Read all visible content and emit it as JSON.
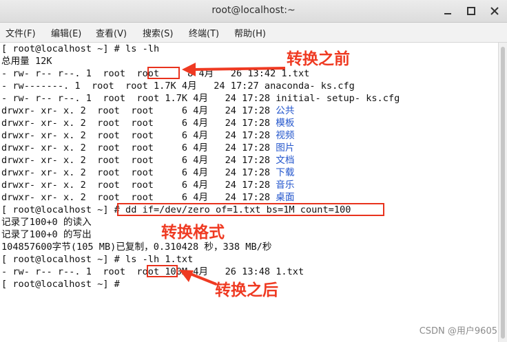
{
  "window": {
    "title": "root@localhost:~",
    "controls": {
      "minimize": "minimize-icon",
      "maximize": "maximize-icon",
      "close": "close-icon"
    }
  },
  "menu": [
    "文件(F)",
    "编辑(E)",
    "查看(V)",
    "搜索(S)",
    "终端(T)",
    "帮助(H)"
  ],
  "terminal": {
    "lines": [
      {
        "text": "[ root@localhost ~] # ls -lh"
      },
      {
        "text": "总用量 12K"
      },
      {
        "text": "- rw- r-- r--. 1  root  root     8 4月   26 13:42 1.txt"
      },
      {
        "text": "- rw-------. 1  root  root 1.7K 4月   24 17:27 anaconda- ks.cfg"
      },
      {
        "text": "- rw- r-- r--. 1  root  root 1.7K 4月   24 17:28 initial- setup- ks.cfg"
      },
      {
        "text": "drwxr- xr- x. 2  root  root     6 4月   24 17:28 ",
        "name": "公共"
      },
      {
        "text": "drwxr- xr- x. 2  root  root     6 4月   24 17:28 ",
        "name": "模板"
      },
      {
        "text": "drwxr- xr- x. 2  root  root     6 4月   24 17:28 ",
        "name": "视频"
      },
      {
        "text": "drwxr- xr- x. 2  root  root     6 4月   24 17:28 ",
        "name": "图片"
      },
      {
        "text": "drwxr- xr- x. 2  root  root     6 4月   24 17:28 ",
        "name": "文档"
      },
      {
        "text": "drwxr- xr- x. 2  root  root     6 4月   24 17:28 ",
        "name": "下载"
      },
      {
        "text": "drwxr- xr- x. 2  root  root     6 4月   24 17:28 ",
        "name": "音乐"
      },
      {
        "text": "drwxr- xr- x. 2  root  root     6 4月   24 17:28 ",
        "name": "桌面"
      },
      {
        "text": "[ root@localhost ~] # dd if=/dev/zero of=1.txt bs=1M count=100"
      },
      {
        "text": "记录了100+0 的读入"
      },
      {
        "text": "记录了100+0 的写出"
      },
      {
        "text": "104857600字节(105 MB)已复制，0.310428 秒，338 MB/秒"
      },
      {
        "text": "[ root@localhost ~] # ls -lh 1.txt"
      },
      {
        "text": "- rw- r-- r--. 1  root  root 100M 4月   26 13:48 1.txt"
      },
      {
        "text": "[ root@localhost ~] # "
      }
    ]
  },
  "annotations": {
    "before": "转换之前",
    "format": "转换格式",
    "after": "转换之后",
    "color": "#ef3a22"
  },
  "watermark": "CSDN @用户9605"
}
